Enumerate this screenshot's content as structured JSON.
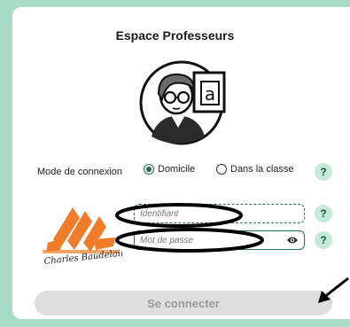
{
  "title": "Espace Professeurs",
  "mode": {
    "label": "Mode de connexion",
    "options": [
      {
        "label": "Domicile",
        "selected": true
      },
      {
        "label": "Dans la classe",
        "selected": false
      }
    ]
  },
  "form": {
    "username_placeholder": "Identifiant",
    "password_placeholder": "Mot de passe",
    "submit_label": "Se connecter"
  },
  "help_label": "?",
  "logo": {
    "text": "Charles Baudelaire"
  },
  "avatar_board_letter": "a",
  "colors": {
    "frame": "#a8dcc7",
    "accent": "#1f6b55",
    "help_bg": "#c4ead8",
    "logo_orange": "#f07c2a",
    "button_bg": "#dedede"
  }
}
